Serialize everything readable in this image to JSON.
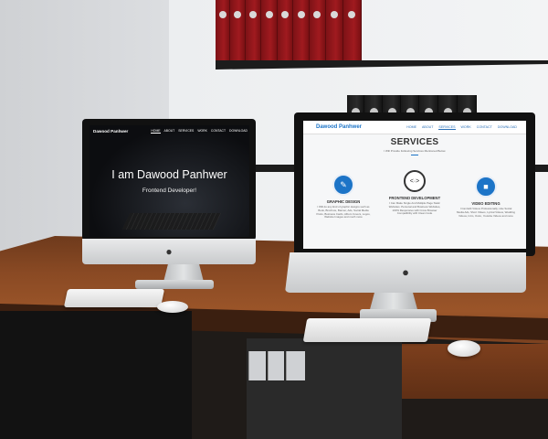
{
  "left_screen": {
    "brand": "Dawood Panhwer",
    "nav": [
      "HOME",
      "ABOUT",
      "SERVICES",
      "WORK",
      "CONTACT",
      "DOWNLOAD"
    ],
    "hero_title": "I am Dawood Panhwer",
    "hero_subtitle": "Frontend Developer!"
  },
  "right_screen": {
    "brand": "Dawood Panhwer",
    "nav": [
      "HOME",
      "ABOUT",
      "SERVICES",
      "WORK",
      "CONTACT",
      "DOWNLOAD"
    ],
    "section_title": "SERVICES",
    "section_tagline": "I Will Provide Following Services Mentioned Below",
    "services": [
      {
        "icon": "brush-icon",
        "title": "GRAPHIC DESIGN",
        "text": "I Will do any kind of graphic designs such as Book, Brochure, Banner, Ads, Social Media Posts, Business Cards, Album Covers, Logos, Website Images and much more"
      },
      {
        "icon": "code-icon",
        "title": "FRONTEND DEVELOPMENT",
        "text": "I Can Make Single And Multiple Page Static Websites. Personal and Business Websites, 100% Responsive with Cross Browser Compatibility with Clean Code"
      },
      {
        "icon": "video-camera-icon",
        "title": "VIDEO EDITING",
        "text": "I Can Edit Videos Professionally, Like Social Media Ads, Short Videos, Lyrical Videos, Wedding Videos, Intro, Outro, Youtube Videos and more"
      }
    ],
    "accent_color": "#1c74c7"
  },
  "logo_glyph": ""
}
